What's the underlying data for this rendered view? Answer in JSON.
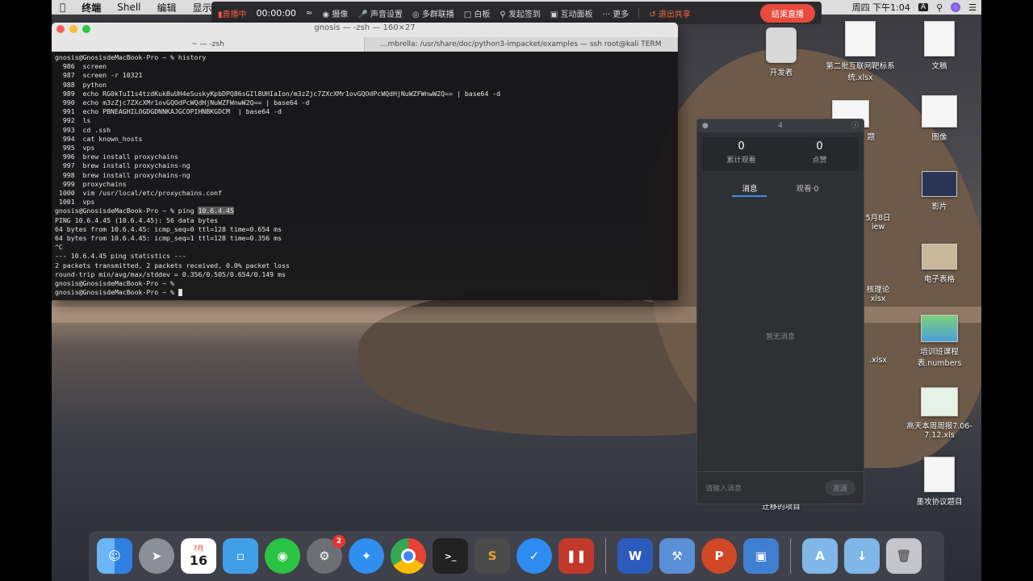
{
  "menubar": {
    "app_name": "终端",
    "items": [
      "Shell",
      "编辑",
      "显示"
    ],
    "clock": "周四 下午1:04"
  },
  "meeting_bar": {
    "live_label": "直播中",
    "timer": "00:00:00",
    "items": [
      "摄像",
      "声音设置",
      "多群联播",
      "白板",
      "发起签到",
      "互动面板",
      "更多"
    ],
    "exit_label": "退出共享",
    "end_label": "结束直播"
  },
  "terminal": {
    "title": "gnosis — -zsh — 160×27",
    "tabs": [
      "~ — -zsh",
      "…mbrella: /usr/share/doc/python3-impacket/examples — ssh root@kali TERM"
    ],
    "lines": [
      "gnosis@GnosisdeMacBook-Pro ~ % history",
      "  986  screen",
      "  987  screen -r 10321",
      "  988  python",
      "  989  echo RG0kTuI1s4tzdKukBuUH4eSuskyKpbDPQ86sGIl8UHIaIon/m3zZjc7ZXcXMr1ovGQOdPcWQdHjNuWZFWnwW2Q== | base64 -d",
      "  990  echo m3zZjc7ZXcXMr1ovGQOdPcWQdHjNuWZFWnwW2Q== | base64 -d",
      "  991  echo PBNEAGHILOGDGDNNKAJGCOPIHNBKGDCM  | base64 -d",
      "  992  ls",
      "  993  cd .ssh",
      "  994  cat known_hosts",
      "  995  vps",
      "  996  brew install proxychains",
      "  997  brew install proxychains-ng",
      "  998  brew install proxychains-ng",
      "  999  proxychains",
      " 1000  vim /usr/local/etc/proxychains.conf",
      " 1001  vps"
    ],
    "ping_prompt": "gnosis@GnosisdeMacBook-Pro ~ % ping ",
    "ping_host": "10.6.4.45",
    "output": [
      "PING 10.6.4.45 (10.6.4.45): 56 data bytes",
      "64 bytes from 10.6.4.45: icmp_seq=0 ttl=128 time=0.654 ms",
      "64 bytes from 10.6.4.45: icmp_seq=1 ttl=128 time=0.356 ms",
      "^C",
      "--- 10.6.4.45 ping statistics ---",
      "2 packets transmitted, 2 packets received, 0.0% packet loss",
      "round-trip min/avg/max/stddev = 0.356/0.505/0.654/0.149 ms",
      "gnosis@GnosisdeMacBook-Pro ~ %"
    ],
    "last_prompt": "gnosis@GnosisdeMacBook-Pro ~ % "
  },
  "desktop_icons": [
    {
      "label": "开发者"
    },
    {
      "label": "第二批互联网靶标系统.xlsx"
    },
    {
      "label": "文稿"
    },
    {
      "label": "图像"
    },
    {
      "label": "影片"
    },
    {
      "label": "电子表格"
    },
    {
      "label": "培训班课程表.numbers"
    },
    {
      "label": "高天本周周报7.06-7.12.xls"
    },
    {
      "label": "墨攻协议题目"
    }
  ],
  "partial_labels": [
    "题",
    "5月8日",
    "iew",
    "核理论",
    "xlsx",
    ".xlsx",
    "迁移的项目"
  ],
  "panel": {
    "title": "4",
    "stats": [
      {
        "value": "0",
        "label": "累计观看"
      },
      {
        "value": "0",
        "label": "点赞"
      }
    ],
    "tabs": [
      "消息",
      "观看·0"
    ],
    "empty_text": "暂无消息",
    "input_placeholder": "请输入消息",
    "send_label": "发送"
  },
  "dock": {
    "calendar_month": "7月",
    "calendar_day": "16",
    "settings_badge": "2"
  }
}
